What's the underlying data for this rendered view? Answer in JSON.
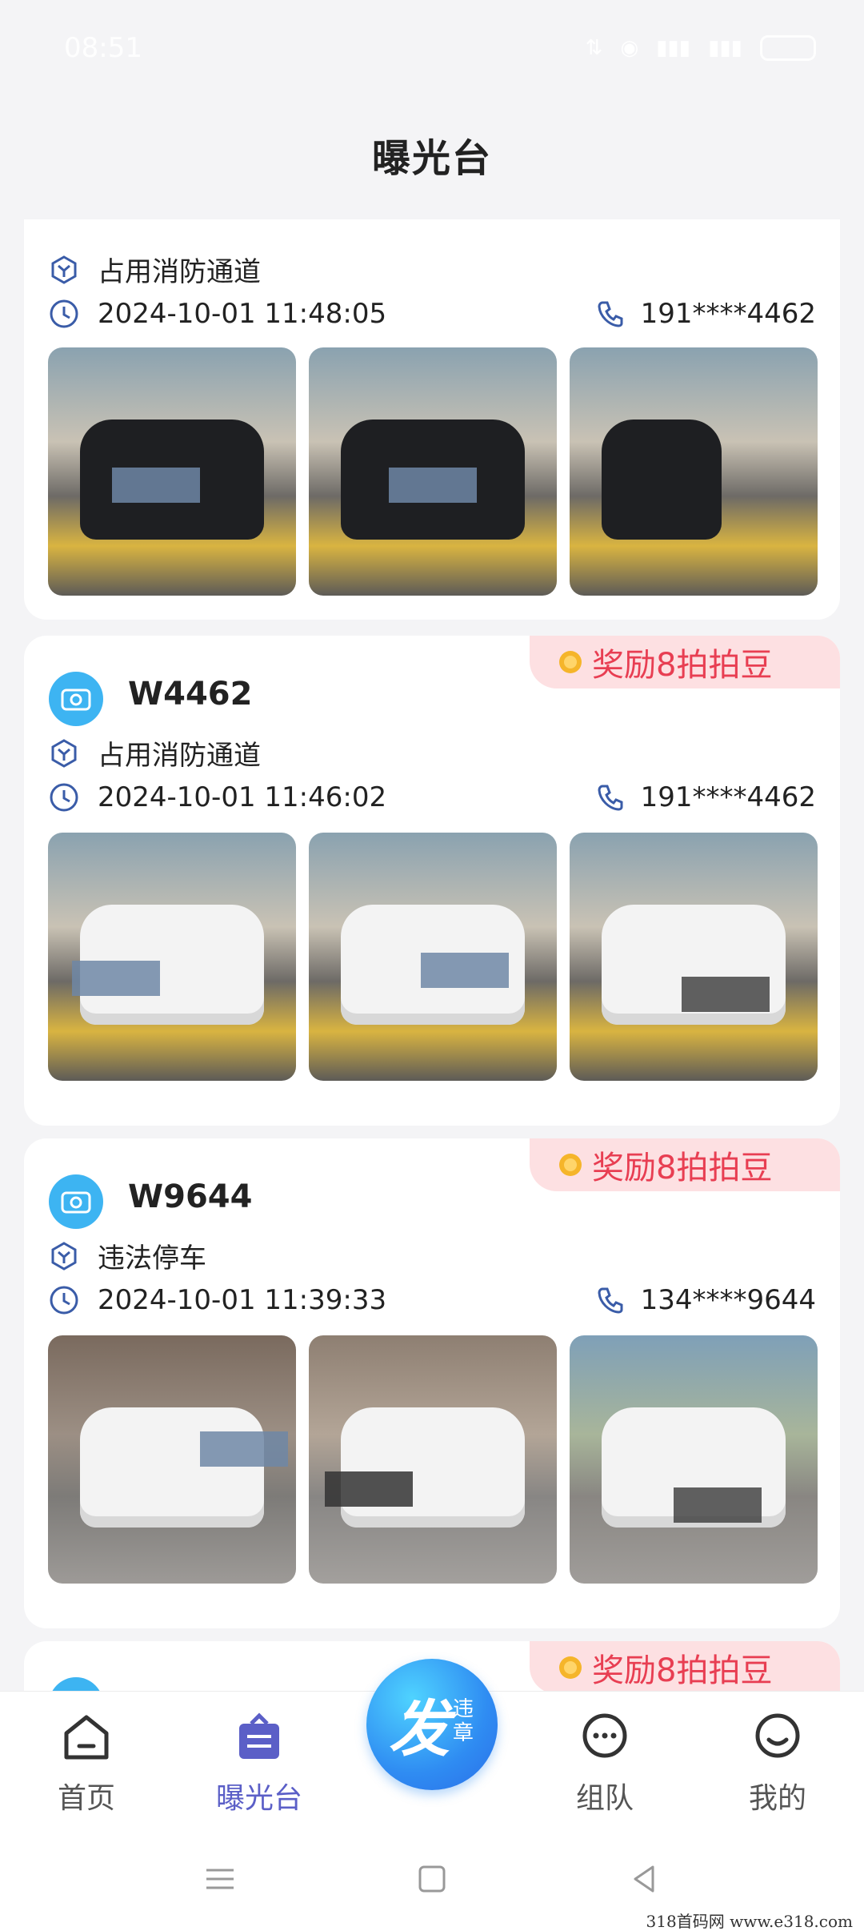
{
  "status_bar": {
    "time": "08:51"
  },
  "header": {
    "title": "曝光台"
  },
  "cards": [
    {
      "plate": "",
      "reward": "",
      "violation": "占用消防通道",
      "time": "2024-10-01 11:48:05",
      "phone": "191****4462",
      "photo_count": 3
    },
    {
      "plate": "W4462",
      "reward": "奖励8拍拍豆",
      "violation": "占用消防通道",
      "time": "2024-10-01 11:46:02",
      "phone": "191****4462",
      "photo_count": 3
    },
    {
      "plate": "W9644",
      "reward": "奖励8拍拍豆",
      "violation": "违法停车",
      "time": "2024-10-01 11:39:33",
      "phone": "134****9644",
      "photo_count": 3
    },
    {
      "plate": "",
      "reward": "奖励8拍拍豆"
    }
  ],
  "nav": {
    "items": [
      {
        "label": "首页",
        "icon": "home-icon"
      },
      {
        "label": "曝光台",
        "icon": "exposure-icon",
        "active": true
      },
      {
        "label": "组队",
        "icon": "chat-icon"
      },
      {
        "label": "我的",
        "icon": "profile-icon"
      }
    ],
    "fab": {
      "big": "发",
      "small": "违章"
    }
  },
  "watermark": "318首码网 www.e318.com",
  "colors": {
    "accent": "#5b5fc7",
    "reward": "#e83e52",
    "fab": "#2f8cf2"
  }
}
